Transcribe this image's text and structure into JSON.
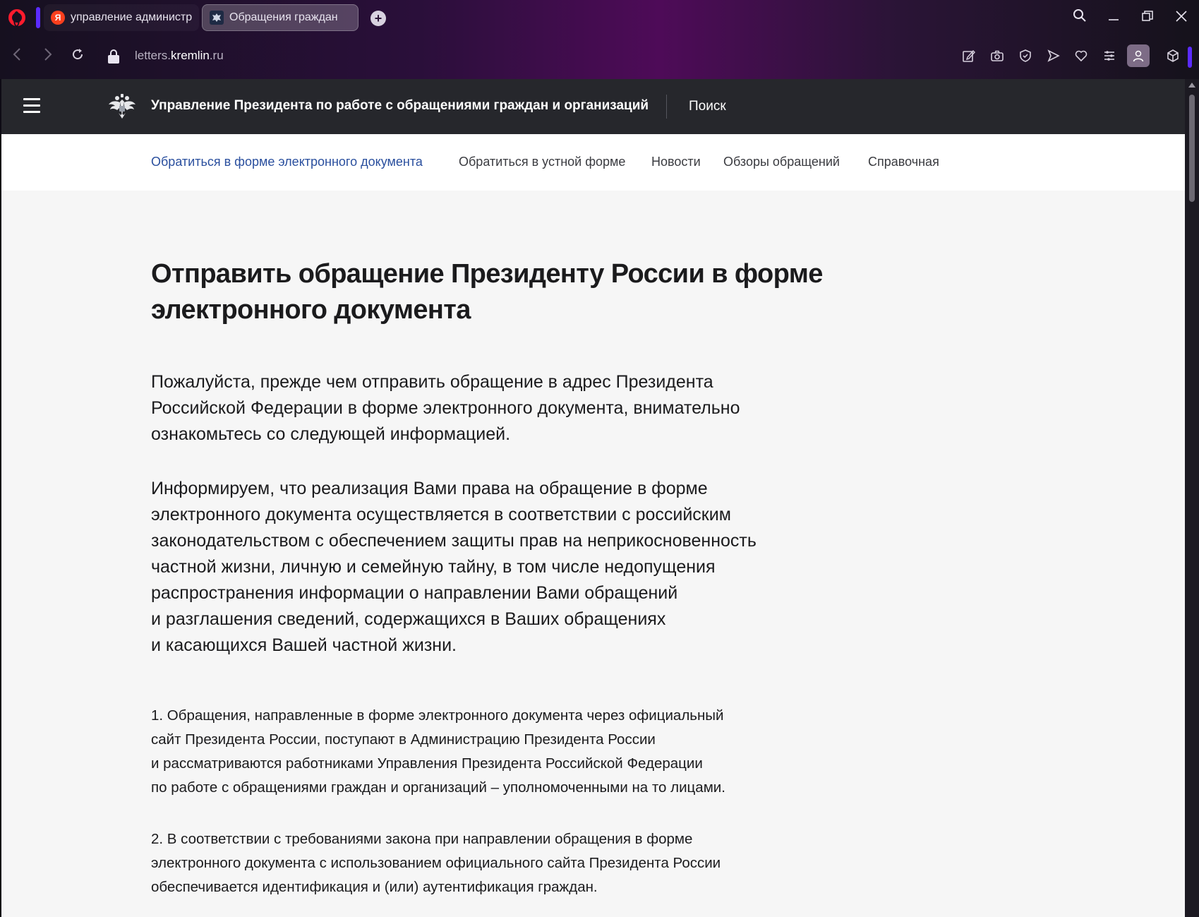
{
  "browser": {
    "tabs": [
      {
        "label": "управление администрац",
        "favicon": "yandex-icon",
        "active": false
      },
      {
        "label": "Обращения граждан",
        "favicon": "kremlin-emblem-icon",
        "active": true
      }
    ],
    "address": {
      "prefix": "letters.",
      "host": "kremlin",
      "suffix": ".ru"
    },
    "accent_color": "#5b2bff",
    "logo_color": "#ff1b2d"
  },
  "site": {
    "title": "Управление Президента по работе с обращениями граждан и организаций",
    "search_label": "Поиск",
    "header_bg": "#26272c"
  },
  "nav": {
    "items": [
      {
        "label": "Обратиться в форме электронного документа",
        "active": true
      },
      {
        "label": "Обратиться в устной форме",
        "active": false
      },
      {
        "label": "Новости",
        "active": false
      },
      {
        "label": "Обзоры обращений",
        "active": false
      },
      {
        "label": "Справочная",
        "active": false
      }
    ],
    "active_color": "#2a4f9e"
  },
  "page": {
    "title_lines": [
      "Отправить обращение Президенту России в форме",
      "электронного документа"
    ],
    "lead_1_lines": [
      "Пожалуйста, прежде чем отправить обращение в адрес Президента",
      "Российской Федерации в форме электронного документа, внимательно",
      "ознакомьтесь со следующей информацией."
    ],
    "lead_2_lines": [
      "Информируем, что реализация Вами права на обращение в форме",
      "электронного документа осуществляется в соответствии с российским",
      "законодательством с обеспечением защиты прав на неприкосновенность",
      "частной жизни, личную и семейную тайну, в том числе недопущения",
      "распространения информации о направлении Вами обращений",
      "и разглашения сведений, содержащихся в Ваших обращениях",
      "и касающихся Вашей частной жизни."
    ],
    "item_1_lines": [
      "1. Обращения, направленные в форме электронного документа через официальный",
      "сайт Президента России, поступают в Администрацию Президента России",
      "и рассматриваются работниками Управления Президента Российской Федерации",
      "по работе с обращениями граждан и организаций – уполномоченными на то лицами."
    ],
    "item_2_lines": [
      "2. В соответствии с требованиями закона при направлении обращения в форме",
      "электронного документа с использованием официального сайта Президента России",
      "обеспечивается идентификация и (или) аутентификация граждан."
    ]
  }
}
